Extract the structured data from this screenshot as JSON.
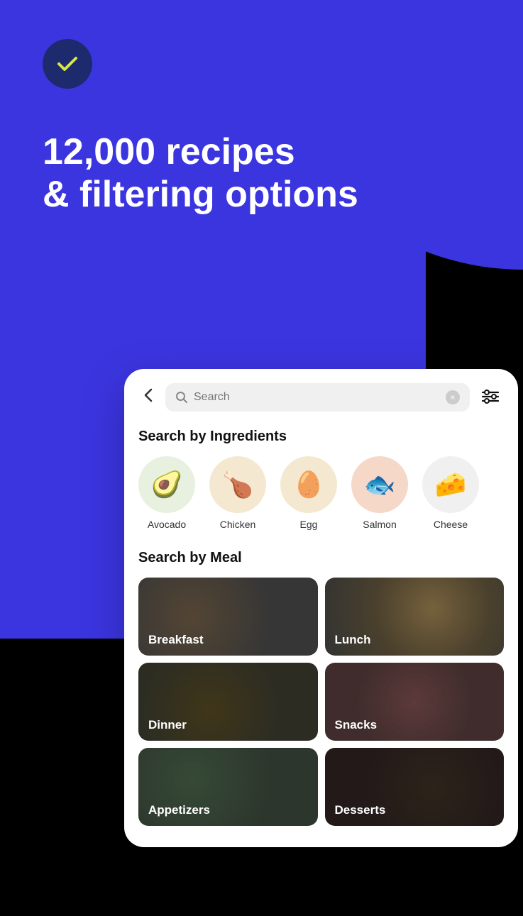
{
  "hero": {
    "title_line1": "12,000 recipes",
    "title_line2": "& filtering options",
    "check_icon": "checkmark"
  },
  "search": {
    "placeholder": "Search",
    "back_label": "‹",
    "clear_label": "×",
    "filter_icon": "sliders-icon"
  },
  "ingredients_section": {
    "title": "Search by Ingredients",
    "items": [
      {
        "label": "Avocado",
        "emoji": "🥑"
      },
      {
        "label": "Chicken",
        "emoji": "🍗"
      },
      {
        "label": "Egg",
        "emoji": "🥚"
      },
      {
        "label": "Salmon",
        "emoji": "🐟"
      },
      {
        "label": "Cheese",
        "emoji": "🧀"
      }
    ]
  },
  "meals_section": {
    "title": "Search by Meal",
    "items": [
      {
        "label": "Breakfast",
        "bg_class": "meal-bg-breakfast"
      },
      {
        "label": "Lunch",
        "bg_class": "meal-bg-lunch"
      },
      {
        "label": "Dinner",
        "bg_class": "meal-bg-dinner"
      },
      {
        "label": "Snacks",
        "bg_class": "meal-bg-snacks"
      },
      {
        "label": "Appetizers",
        "bg_class": "meal-bg-appetizers"
      },
      {
        "label": "Desserts",
        "bg_class": "meal-bg-desserts"
      }
    ]
  }
}
